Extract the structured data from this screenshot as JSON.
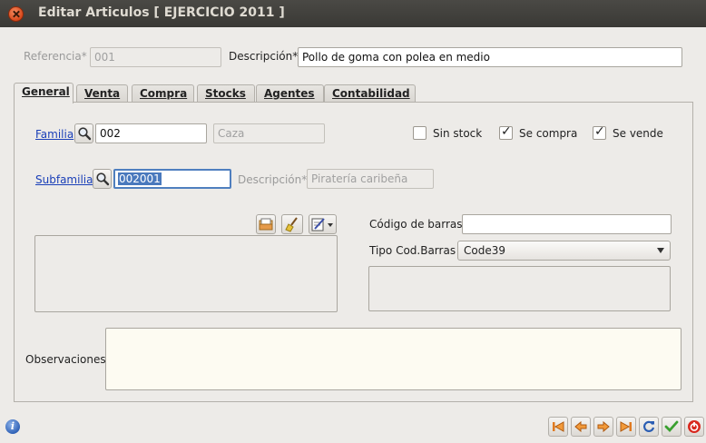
{
  "window": {
    "title": "Editar Articulos [ EJERCICIO 2011 ]"
  },
  "header": {
    "referencia_label": "Referencia*",
    "referencia_value": "001",
    "descripcion_label": "Descripción*",
    "descripcion_value": "Pollo de goma con polea en medio"
  },
  "tabs": [
    {
      "label": "General",
      "active": true
    },
    {
      "label": "Venta"
    },
    {
      "label": "Compra"
    },
    {
      "label": "Stocks"
    },
    {
      "label": "Agentes"
    },
    {
      "label": "Contabilidad"
    }
  ],
  "general": {
    "familia_label": "Familia",
    "familia_code": "002",
    "familia_name": "Caza",
    "sin_stock_label": "Sin stock",
    "sin_stock_checked": false,
    "se_compra_label": "Se compra",
    "se_compra_checked": true,
    "se_vende_label": "Se vende",
    "se_vende_checked": true,
    "subfamilia_label": "Subfamilia",
    "subfamilia_code": "002001",
    "subfam_desc_label": "Descripción*",
    "subfam_desc_value": "Piratería caribeña",
    "codigo_barras_label": "Código de barras",
    "codigo_barras_value": "",
    "tipo_cod_label": "Tipo Cod.Barras",
    "tipo_cod_value": "Code39",
    "observaciones_label": "Observaciones",
    "observaciones_value": ""
  },
  "colors": {
    "link": "#1a3fb8",
    "selection": "#4a79bd",
    "titlebar": "#3f3e3a"
  }
}
